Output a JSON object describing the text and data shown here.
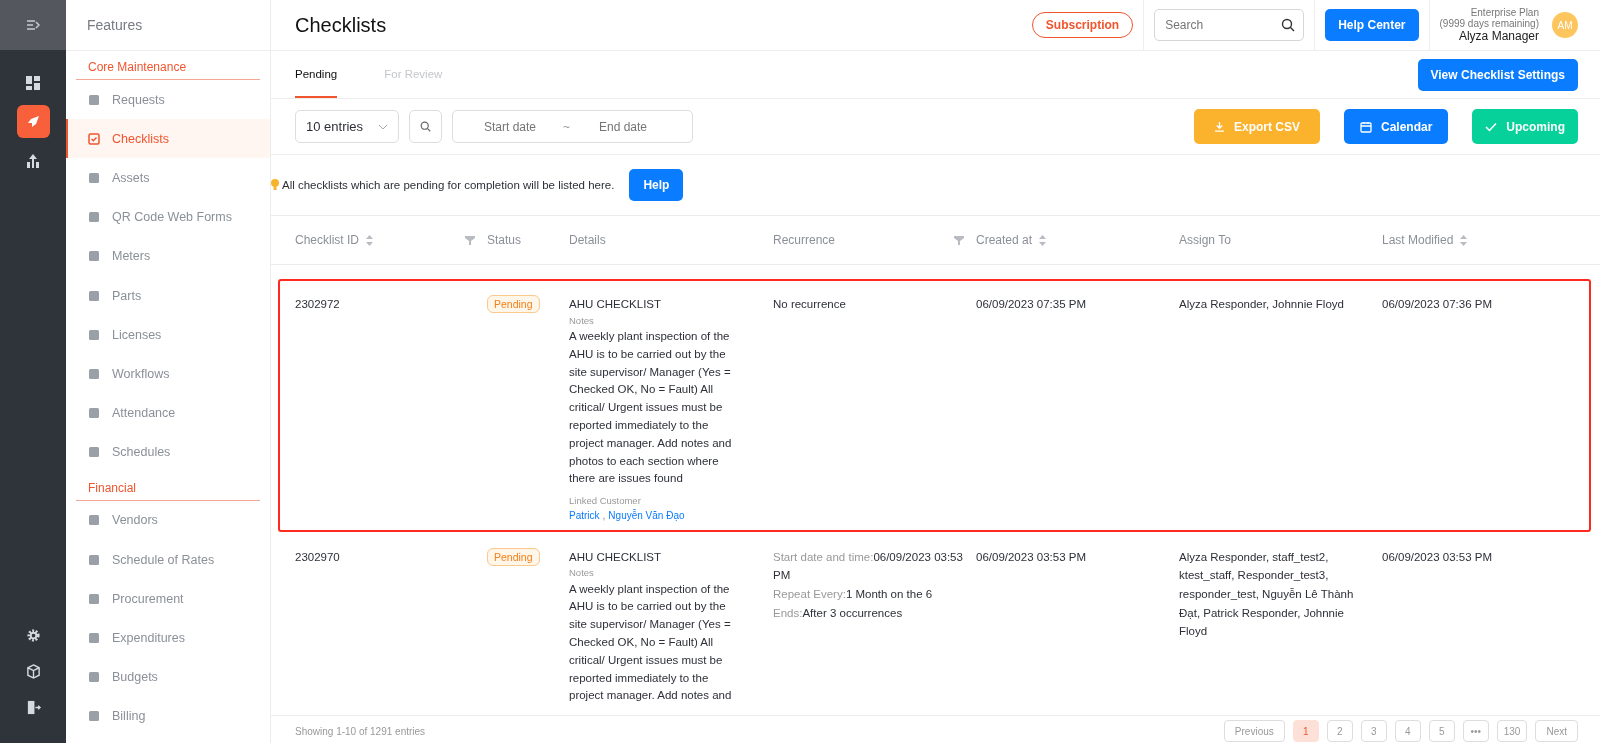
{
  "sidebar": {
    "title": "Features",
    "sections": [
      {
        "heading": "Core Maintenance",
        "items": [
          {
            "label": "Requests",
            "selected": false
          },
          {
            "label": "Checklists",
            "selected": true
          },
          {
            "label": "Assets",
            "selected": false
          },
          {
            "label": "QR Code Web Forms",
            "selected": false
          },
          {
            "label": "Meters",
            "selected": false
          },
          {
            "label": "Parts",
            "selected": false
          },
          {
            "label": "Licenses",
            "selected": false
          },
          {
            "label": "Workflows",
            "selected": false
          },
          {
            "label": "Attendance",
            "selected": false
          },
          {
            "label": "Schedules",
            "selected": false
          }
        ]
      },
      {
        "heading": "Financial",
        "items": [
          {
            "label": "Vendors",
            "selected": false
          },
          {
            "label": "Schedule of Rates",
            "selected": false
          },
          {
            "label": "Procurement",
            "selected": false
          },
          {
            "label": "Expenditures",
            "selected": false
          },
          {
            "label": "Budgets",
            "selected": false
          },
          {
            "label": "Billing",
            "selected": false
          }
        ]
      }
    ]
  },
  "rail": {
    "items": [
      {
        "selected": false
      },
      {
        "selected": true
      },
      {
        "selected": false
      }
    ]
  },
  "header": {
    "title": "Checklists",
    "subscription": "Subscription",
    "search_placeholder": "Search",
    "help_center": "Help Center",
    "plan": "Enterprise Plan",
    "remaining": "(9999 days remaining)",
    "user": "Alyza Manager",
    "avatar": "AM"
  },
  "tabs": [
    {
      "label": "Pending",
      "selected": true
    },
    {
      "label": "For Review",
      "selected": false
    }
  ],
  "settings_button": "View Checklist Settings",
  "toolbar": {
    "entries": "10 entries",
    "start_placeholder": "Start date",
    "separator": "~",
    "end_placeholder": "End date",
    "export": "Export CSV",
    "calendar": "Calendar",
    "upcoming": "Upcoming"
  },
  "info": {
    "text": "All checklists which are pending for completion will be listed here.",
    "help": "Help"
  },
  "table": {
    "columns": [
      {
        "label": "Checklist ID",
        "sortable": true,
        "filter": true
      },
      {
        "label": "Status",
        "sortable": false,
        "filter": false
      },
      {
        "label": "Details",
        "sortable": false,
        "filter": false
      },
      {
        "label": "Recurrence",
        "sortable": false,
        "filter": true
      },
      {
        "label": "Created at",
        "sortable": true,
        "filter": false
      },
      {
        "label": "Assign To",
        "sortable": false,
        "filter": false
      },
      {
        "label": "Last Modified",
        "sortable": true,
        "filter": false
      }
    ],
    "rows": [
      {
        "highlighted": true,
        "id": "2302972",
        "status": "Pending",
        "title": "AHU CHECKLIST",
        "notes_label": "Notes",
        "notes": "A weekly plant inspection of the AHU is to be carried out by the site supervisor/ Manager (Yes = Checked OK, No = Fault) All critical/ Urgent issues must be reported immediately to the project manager. Add notes and photos to each section where there are issues found",
        "customer_label": "Linked Customer",
        "customers": [
          "Patrick",
          "Nguyễn Văn Đạo"
        ],
        "customer_sep": ",",
        "recurrence": [
          {
            "value": "No recurrence"
          }
        ],
        "created": "06/09/2023 07:35 PM",
        "assign": "Alyza Responder, Johnnie Floyd",
        "modified": "06/09/2023 07:36 PM"
      },
      {
        "highlighted": false,
        "id": "2302970",
        "status": "Pending",
        "title": "AHU CHECKLIST",
        "notes_label": "Notes",
        "notes": "A weekly plant inspection of the AHU is to be carried out by the site supervisor/ Manager (Yes = Checked OK, No = Fault) All critical/ Urgent issues must be reported immediately to the project manager. Add notes and",
        "recurrence": [
          {
            "label": "Start date and time:",
            "value": "06/09/2023 03:53 PM"
          },
          {
            "label": "Repeat Every:",
            "value": "1 Month on the 6"
          },
          {
            "label": "Ends:",
            "value": "After 3 occurrences"
          }
        ],
        "created": "06/09/2023 03:53 PM",
        "assign": "Alyza Responder, staff_test2, ktest_staff, Responder_test3, responder_test, Nguyễn Lê Thành Đạt, Patrick Responder, Johnnie Floyd",
        "modified": "06/09/2023 03:53 PM"
      }
    ]
  },
  "footer": {
    "showing": "Showing 1-10 of 1291 entries",
    "previous": "Previous",
    "pages": [
      {
        "label": "1",
        "selected": true
      },
      {
        "label": "2",
        "selected": false
      },
      {
        "label": "3",
        "selected": false
      },
      {
        "label": "4",
        "selected": false
      },
      {
        "label": "5",
        "selected": false
      },
      {
        "label": "•••",
        "selected": false
      },
      {
        "label": "130",
        "selected": false
      }
    ],
    "next": "Next"
  }
}
